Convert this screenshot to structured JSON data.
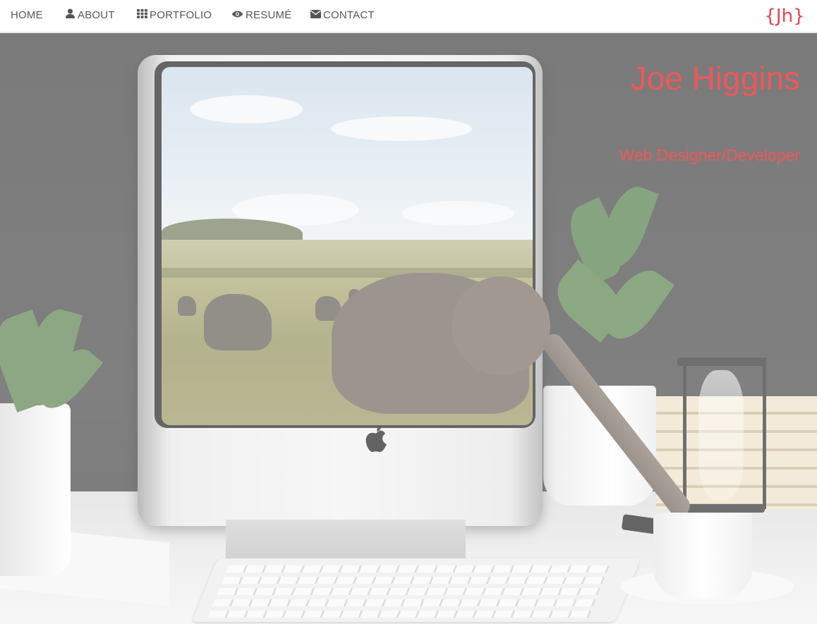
{
  "nav": {
    "items": [
      {
        "label": "HOME",
        "icon": "none"
      },
      {
        "label": "ABOUT",
        "icon": "user-icon"
      },
      {
        "label": "PORTFOLIO",
        "icon": "grid-icon"
      },
      {
        "label": "RESUMÉ",
        "icon": "eye-icon"
      },
      {
        "label": "CONTACT",
        "icon": "envelope-icon"
      }
    ],
    "logo_text": "{Jh}"
  },
  "hero": {
    "name": "Joe Higgins",
    "tagline": "Web Designer/Developer"
  },
  "colors": {
    "accent": "#f0575a",
    "nav_text": "#555555",
    "nav_bg": "#ffffff"
  }
}
